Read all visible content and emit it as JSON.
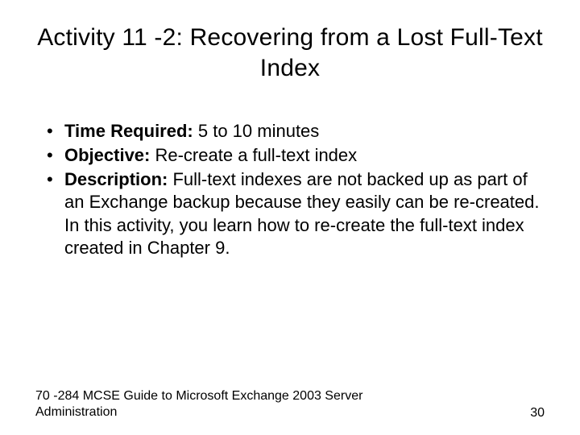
{
  "title": "Activity 11 -2: Recovering from a Lost Full-Text Index",
  "bullets": [
    {
      "label": "Time Required:",
      "text": " 5 to 10 minutes"
    },
    {
      "label": "Objective:",
      "text": " Re-create a full-text index"
    },
    {
      "label": "Description:",
      "text": " Full-text indexes are not backed up as part of an Exchange backup because they easily can be re-created. In this activity, you learn how to re-create the full-text index created in Chapter 9."
    }
  ],
  "footer": {
    "text": "70 -284 MCSE Guide to Microsoft Exchange 2003 Server Administration",
    "page": "30"
  }
}
